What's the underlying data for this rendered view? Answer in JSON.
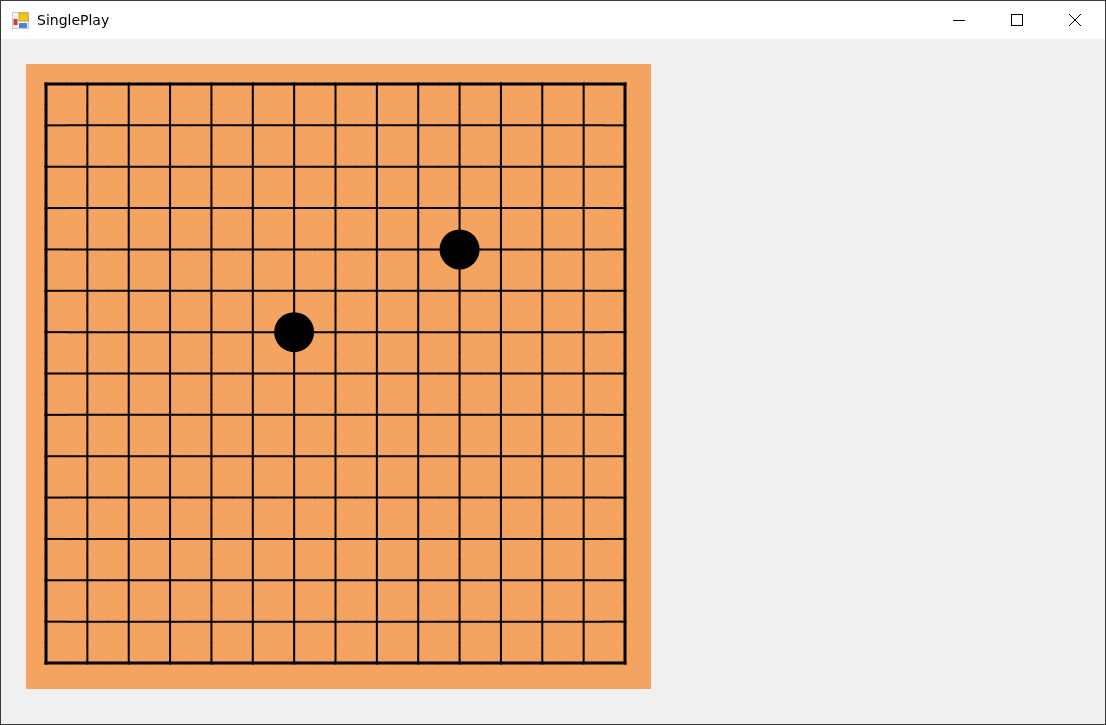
{
  "window": {
    "title": "SinglePlay"
  },
  "board": {
    "rows": [
      [
        {
          "stone": false
        },
        {
          "stone": false
        },
        {
          "stone": false
        },
        {
          "stone": false
        },
        {
          "stone": false
        },
        {
          "stone": false
        },
        {
          "stone": false
        },
        {
          "stone": false
        },
        {
          "stone": false
        },
        {
          "stone": false
        },
        {
          "stone": false
        },
        {
          "stone": false
        },
        {
          "stone": false
        },
        {
          "stone": false
        },
        {
          "stone": false
        }
      ],
      [
        {
          "stone": false
        },
        {
          "stone": false
        },
        {
          "stone": false
        },
        {
          "stone": false
        },
        {
          "stone": false
        },
        {
          "stone": false
        },
        {
          "stone": false
        },
        {
          "stone": false
        },
        {
          "stone": false
        },
        {
          "stone": false
        },
        {
          "stone": false
        },
        {
          "stone": false
        },
        {
          "stone": false
        },
        {
          "stone": false
        },
        {
          "stone": false
        }
      ],
      [
        {
          "stone": false
        },
        {
          "stone": false
        },
        {
          "stone": false
        },
        {
          "stone": false
        },
        {
          "stone": false
        },
        {
          "stone": false
        },
        {
          "stone": false
        },
        {
          "stone": false
        },
        {
          "stone": false
        },
        {
          "stone": false
        },
        {
          "stone": false
        },
        {
          "stone": false
        },
        {
          "stone": false
        },
        {
          "stone": false
        },
        {
          "stone": false
        }
      ],
      [
        {
          "stone": false
        },
        {
          "stone": false
        },
        {
          "stone": false
        },
        {
          "stone": false
        },
        {
          "stone": false
        },
        {
          "stone": false
        },
        {
          "stone": false
        },
        {
          "stone": false
        },
        {
          "stone": false
        },
        {
          "stone": false
        },
        {
          "stone": false
        },
        {
          "stone": false
        },
        {
          "stone": false
        },
        {
          "stone": false
        },
        {
          "stone": false
        }
      ],
      [
        {
          "stone": false
        },
        {
          "stone": false
        },
        {
          "stone": false
        },
        {
          "stone": false
        },
        {
          "stone": false
        },
        {
          "stone": false
        },
        {
          "stone": false
        },
        {
          "stone": false
        },
        {
          "stone": false
        },
        {
          "stone": false
        },
        {
          "stone": true
        },
        {
          "stone": false
        },
        {
          "stone": false
        },
        {
          "stone": false
        },
        {
          "stone": false
        }
      ],
      [
        {
          "stone": false
        },
        {
          "stone": false
        },
        {
          "stone": false
        },
        {
          "stone": false
        },
        {
          "stone": false
        },
        {
          "stone": false
        },
        {
          "stone": false
        },
        {
          "stone": false
        },
        {
          "stone": false
        },
        {
          "stone": false
        },
        {
          "stone": false
        },
        {
          "stone": false
        },
        {
          "stone": false
        },
        {
          "stone": false
        },
        {
          "stone": false
        }
      ],
      [
        {
          "stone": false
        },
        {
          "stone": false
        },
        {
          "stone": false
        },
        {
          "stone": false
        },
        {
          "stone": false
        },
        {
          "stone": false
        },
        {
          "stone": true
        },
        {
          "stone": false
        },
        {
          "stone": false
        },
        {
          "stone": false
        },
        {
          "stone": false
        },
        {
          "stone": false
        },
        {
          "stone": false
        },
        {
          "stone": false
        },
        {
          "stone": false
        }
      ],
      [
        {
          "stone": false
        },
        {
          "stone": false
        },
        {
          "stone": false
        },
        {
          "stone": false
        },
        {
          "stone": false
        },
        {
          "stone": false
        },
        {
          "stone": false
        },
        {
          "stone": false
        },
        {
          "stone": false
        },
        {
          "stone": false
        },
        {
          "stone": false
        },
        {
          "stone": false
        },
        {
          "stone": false
        },
        {
          "stone": false
        },
        {
          "stone": false
        }
      ],
      [
        {
          "stone": false
        },
        {
          "stone": false
        },
        {
          "stone": false
        },
        {
          "stone": false
        },
        {
          "stone": false
        },
        {
          "stone": false
        },
        {
          "stone": false
        },
        {
          "stone": false
        },
        {
          "stone": false
        },
        {
          "stone": false
        },
        {
          "stone": false
        },
        {
          "stone": false
        },
        {
          "stone": false
        },
        {
          "stone": false
        },
        {
          "stone": false
        }
      ],
      [
        {
          "stone": false
        },
        {
          "stone": false
        },
        {
          "stone": false
        },
        {
          "stone": false
        },
        {
          "stone": false
        },
        {
          "stone": false
        },
        {
          "stone": false
        },
        {
          "stone": false
        },
        {
          "stone": false
        },
        {
          "stone": false
        },
        {
          "stone": false
        },
        {
          "stone": false
        },
        {
          "stone": false
        },
        {
          "stone": false
        },
        {
          "stone": false
        }
      ],
      [
        {
          "stone": false
        },
        {
          "stone": false
        },
        {
          "stone": false
        },
        {
          "stone": false
        },
        {
          "stone": false
        },
        {
          "stone": false
        },
        {
          "stone": false
        },
        {
          "stone": false
        },
        {
          "stone": false
        },
        {
          "stone": false
        },
        {
          "stone": false
        },
        {
          "stone": false
        },
        {
          "stone": false
        },
        {
          "stone": false
        },
        {
          "stone": false
        }
      ],
      [
        {
          "stone": false
        },
        {
          "stone": false
        },
        {
          "stone": false
        },
        {
          "stone": false
        },
        {
          "stone": false
        },
        {
          "stone": false
        },
        {
          "stone": false
        },
        {
          "stone": false
        },
        {
          "stone": false
        },
        {
          "stone": false
        },
        {
          "stone": false
        },
        {
          "stone": false
        },
        {
          "stone": false
        },
        {
          "stone": false
        },
        {
          "stone": false
        }
      ],
      [
        {
          "stone": false
        },
        {
          "stone": false
        },
        {
          "stone": false
        },
        {
          "stone": false
        },
        {
          "stone": false
        },
        {
          "stone": false
        },
        {
          "stone": false
        },
        {
          "stone": false
        },
        {
          "stone": false
        },
        {
          "stone": false
        },
        {
          "stone": false
        },
        {
          "stone": false
        },
        {
          "stone": false
        },
        {
          "stone": false
        },
        {
          "stone": false
        }
      ],
      [
        {
          "stone": false
        },
        {
          "stone": false
        },
        {
          "stone": false
        },
        {
          "stone": false
        },
        {
          "stone": false
        },
        {
          "stone": false
        },
        {
          "stone": false
        },
        {
          "stone": false
        },
        {
          "stone": false
        },
        {
          "stone": false
        },
        {
          "stone": false
        },
        {
          "stone": false
        },
        {
          "stone": false
        },
        {
          "stone": false
        },
        {
          "stone": false
        }
      ],
      [
        {
          "stone": false
        },
        {
          "stone": false
        },
        {
          "stone": false
        },
        {
          "stone": false
        },
        {
          "stone": false
        },
        {
          "stone": false
        },
        {
          "stone": false
        },
        {
          "stone": false
        },
        {
          "stone": false
        },
        {
          "stone": false
        },
        {
          "stone": false
        },
        {
          "stone": false
        },
        {
          "stone": false
        },
        {
          "stone": false
        },
        {
          "stone": false
        }
      ]
    ]
  }
}
